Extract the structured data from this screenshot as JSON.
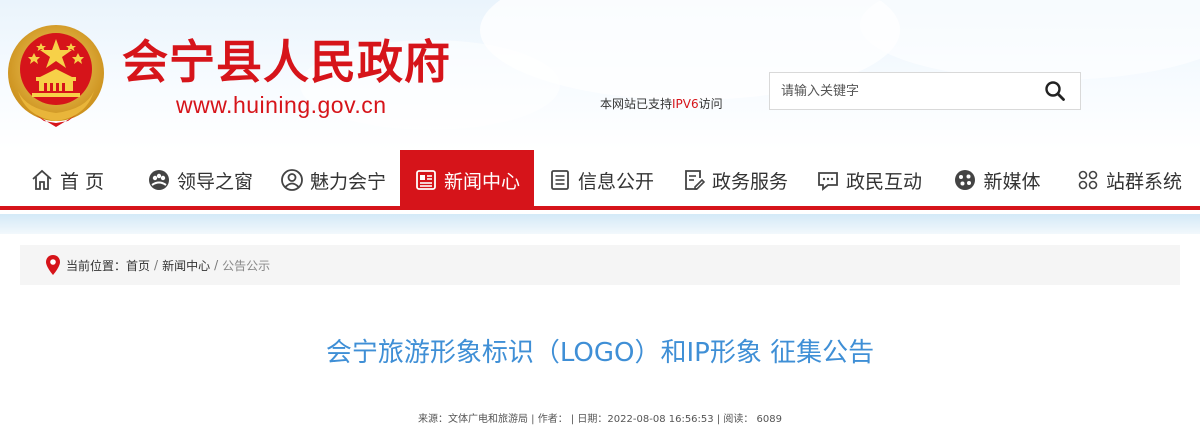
{
  "header": {
    "site_title": "会宁县人民政府",
    "site_url": "www.huining.gov.cn",
    "ipv6_prefix": "本网站已支持",
    "ipv6_highlight": "IPV6",
    "ipv6_suffix": "访问",
    "emblem_icon": "national-emblem-icon"
  },
  "search": {
    "placeholder": "请输入关键字",
    "value": "",
    "icon": "search-icon"
  },
  "nav": {
    "items": [
      {
        "label": "首 页",
        "icon": "home-icon"
      },
      {
        "label": "领导之窗",
        "icon": "leaders-icon"
      },
      {
        "label": "魅力会宁",
        "icon": "person-icon"
      },
      {
        "label": "新闻中心",
        "icon": "news-icon",
        "active": true
      },
      {
        "label": "信息公开",
        "icon": "document-icon"
      },
      {
        "label": "政务服务",
        "icon": "edit-icon"
      },
      {
        "label": "政民互动",
        "icon": "chat-icon"
      },
      {
        "label": "新媒体",
        "icon": "media-icon"
      },
      {
        "label": "站群系统",
        "icon": "sites-icon"
      }
    ]
  },
  "breadcrumb": {
    "label": "当前位置：",
    "items": [
      "首页",
      "新闻中心",
      "公告公示"
    ],
    "separator": "/",
    "icon": "location-pin-icon"
  },
  "article": {
    "title": "会宁旅游形象标识（LOGO）和IP形象 征集公告",
    "meta": "来源：文体广电和旅游局 | 作者：  | 日期：2022-08-08 16:56:53 | 阅读：  6089"
  },
  "colors": {
    "brand_red": "#d6141a",
    "title_blue": "#3f8fd6",
    "breadcrumb_bg": "#f5f5f5"
  }
}
